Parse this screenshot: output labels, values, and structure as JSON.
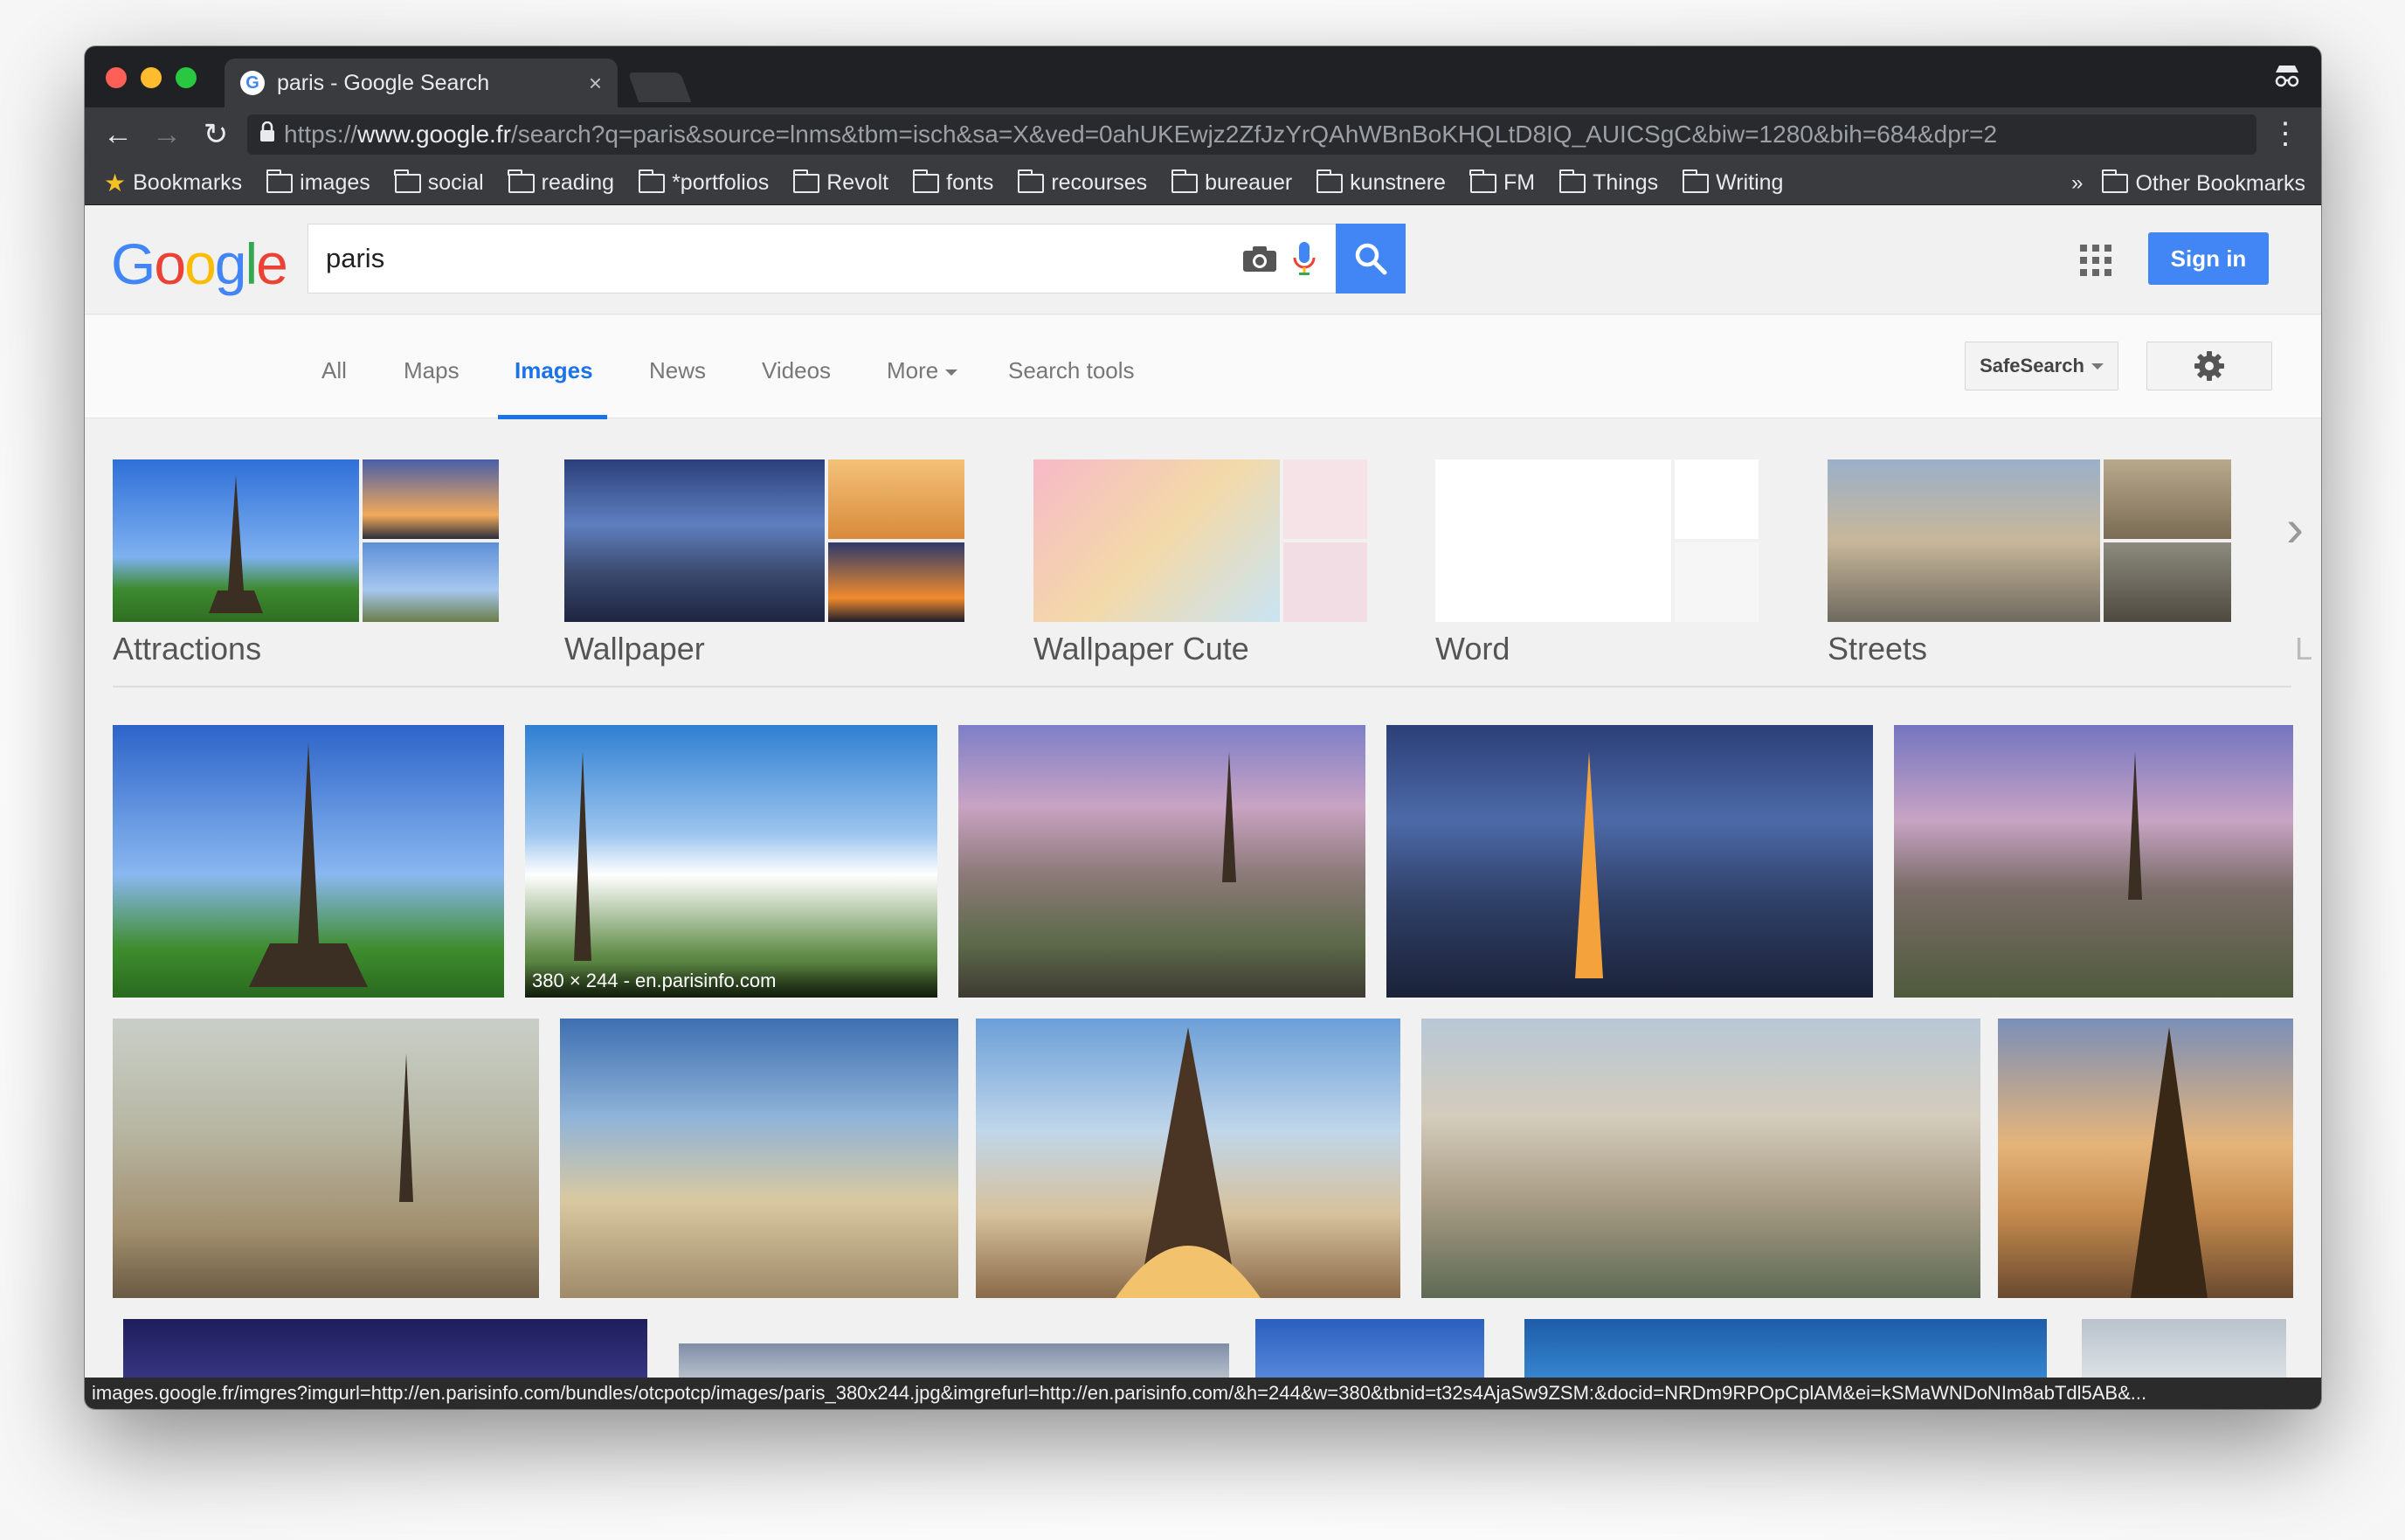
{
  "browser": {
    "tab_title": "paris - Google Search",
    "tab_close": "×",
    "url_scheme": "https://",
    "url_host": "www.google.fr",
    "url_path": "/search?q=paris&source=lnms&tbm=isch&sa=X&ved=0ahUKEwjz2ZfJzYrQAhWBnBoKHQLtD8IQ_AUICSgC&biw=1280&bih=684&dpr=2",
    "bookmarks": [
      "Bookmarks",
      "images",
      "social",
      "reading",
      "*portfolios",
      "Revolt",
      "fonts",
      "recourses",
      "bureauer",
      "kunstnere",
      "FM",
      "Things",
      "Writing"
    ],
    "bookmarks_overflow": "»",
    "other_bookmarks": "Other Bookmarks",
    "status_url": "images.google.fr/imgres?imgurl=http://en.parisinfo.com/bundles/otcpotcp/images/paris_380x244.jpg&imgrefurl=http://en.parisinfo.com/&h=244&w=380&tbnid=t32s4AjaSw9ZSM:&docid=NRDm9RPOpCplAM&ei=kSMaWNDoNIm8abTdl5AB&..."
  },
  "google": {
    "logo": [
      "G",
      "o",
      "o",
      "g",
      "l",
      "e"
    ],
    "logo_colors": [
      "#4285f4",
      "#ea4335",
      "#fbbc05",
      "#4285f4",
      "#34a853",
      "#ea4335"
    ],
    "search_value": "paris",
    "sign_in": "Sign in",
    "nav": [
      "All",
      "Maps",
      "Images",
      "News",
      "Videos",
      "More",
      "Search tools"
    ],
    "active_nav": "Images",
    "safesearch": "SafeSearch",
    "related": [
      "Attractions",
      "Wallpaper",
      "Wallpaper Cute",
      "Word",
      "Streets",
      "L"
    ],
    "hover_caption": "380 × 244 - en.parisinfo.com"
  },
  "colors": {
    "accent": "#4285f4",
    "active_tab": "#1a73e8"
  }
}
